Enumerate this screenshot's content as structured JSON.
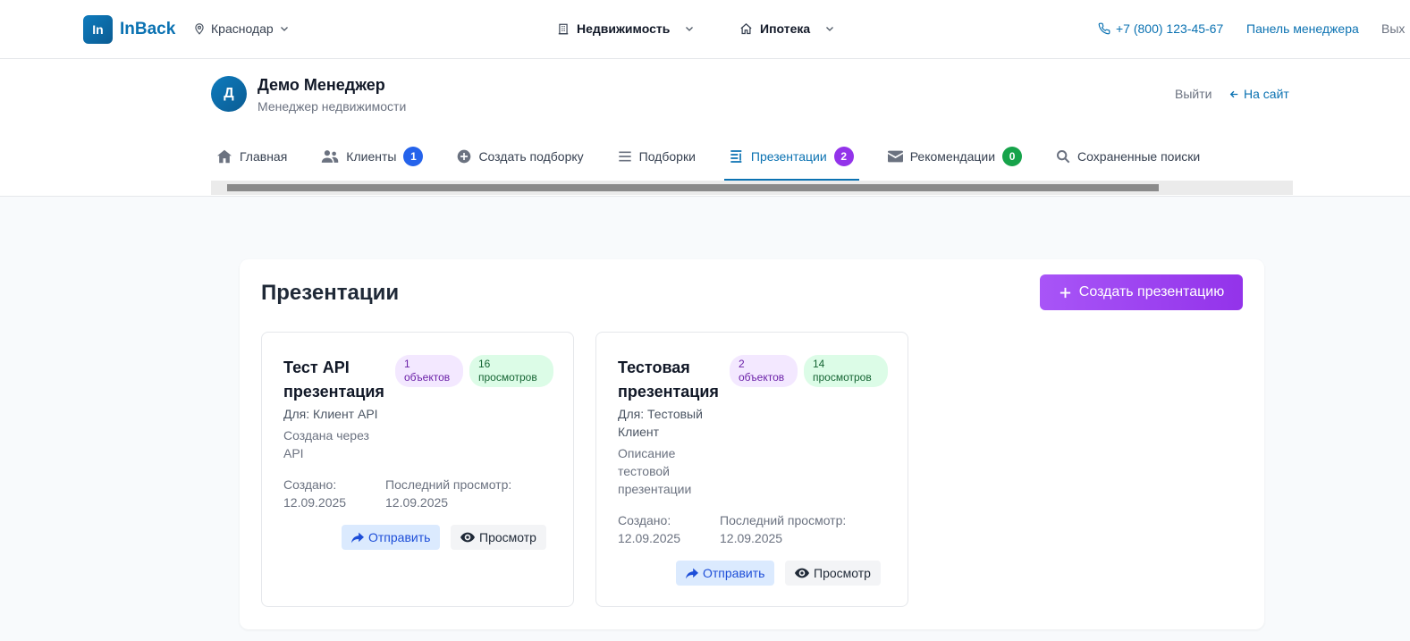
{
  "header": {
    "logo_mark": "In",
    "logo_text": "InBack",
    "city": "Краснодар",
    "nav": [
      {
        "label": "Недвижимость",
        "icon": "building-icon"
      },
      {
        "label": "Ипотека",
        "icon": "home-icon"
      }
    ],
    "phone": "+7 (800) 123-45-67",
    "manager_panel": "Панель менеджера",
    "logout": "Вых"
  },
  "profile": {
    "avatar_letter": "Д",
    "name": "Демо Менеджер",
    "role": "Менеджер недвижимости",
    "logout": "Выйти",
    "to_site": "На сайт"
  },
  "tabs": [
    {
      "label": "Главная",
      "icon": "home-icon"
    },
    {
      "label": "Клиенты",
      "icon": "users-icon",
      "badge": "1",
      "badge_color": "#2563eb"
    },
    {
      "label": "Создать подборку",
      "icon": "plus-circle-icon"
    },
    {
      "label": "Подборки",
      "icon": "list-icon"
    },
    {
      "label": "Презентации",
      "icon": "presentation-icon",
      "badge": "2",
      "badge_color": "#9333ea",
      "active": true
    },
    {
      "label": "Рекомендации",
      "icon": "envelope-icon",
      "badge": "0",
      "badge_color": "#16a34a"
    },
    {
      "label": "Сохраненные поиски",
      "icon": "search-icon"
    }
  ],
  "main": {
    "title": "Презентации",
    "create_button": "Создать презентацию",
    "cards": [
      {
        "title": "Тест API презентация",
        "objects": "1 объектов",
        "views": "16 просмотров",
        "for": "Для: Клиент API",
        "description": "Создана через API",
        "created_label": "Создано:",
        "created": "12.09.2025",
        "last_view_label": "Последний просмотр:",
        "last_view": "12.09.2025",
        "send": "Отправить",
        "view": "Просмотр"
      },
      {
        "title": "Тестовая презентация",
        "objects": "2 объектов",
        "views": "14 просмотров",
        "for": "Для: Тестовый Клиент",
        "description": "Описание тестовой презентации",
        "created_label": "Создано:",
        "created": "12.09.2025",
        "last_view_label": "Последний просмотр:",
        "last_view": "12.09.2025",
        "send": "Отправить",
        "view": "Просмотр"
      }
    ]
  }
}
